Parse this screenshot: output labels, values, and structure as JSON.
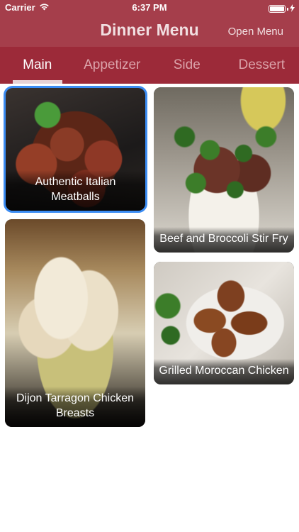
{
  "status_bar": {
    "carrier": "Carrier",
    "time": "6:37 PM"
  },
  "nav": {
    "title": "Dinner Menu",
    "right_button": "Open Menu"
  },
  "tabs": [
    {
      "label": "Main",
      "active": true
    },
    {
      "label": "Appetizer",
      "active": false
    },
    {
      "label": "Side",
      "active": false
    },
    {
      "label": "Dessert",
      "active": false
    }
  ],
  "recipes": [
    {
      "title": "Authentic Italian Meatballs",
      "selected": true
    },
    {
      "title": "Beef and Broccoli Stir Fry",
      "selected": false
    },
    {
      "title": "Dijon Tarragon Chicken Breasts",
      "selected": false
    },
    {
      "title": "Grilled Moroccan Chicken",
      "selected": false
    }
  ],
  "colors": {
    "nav_bar": "#a53e4b",
    "tab_bar": "#9c2a39",
    "selection": "#3b8cf3"
  }
}
